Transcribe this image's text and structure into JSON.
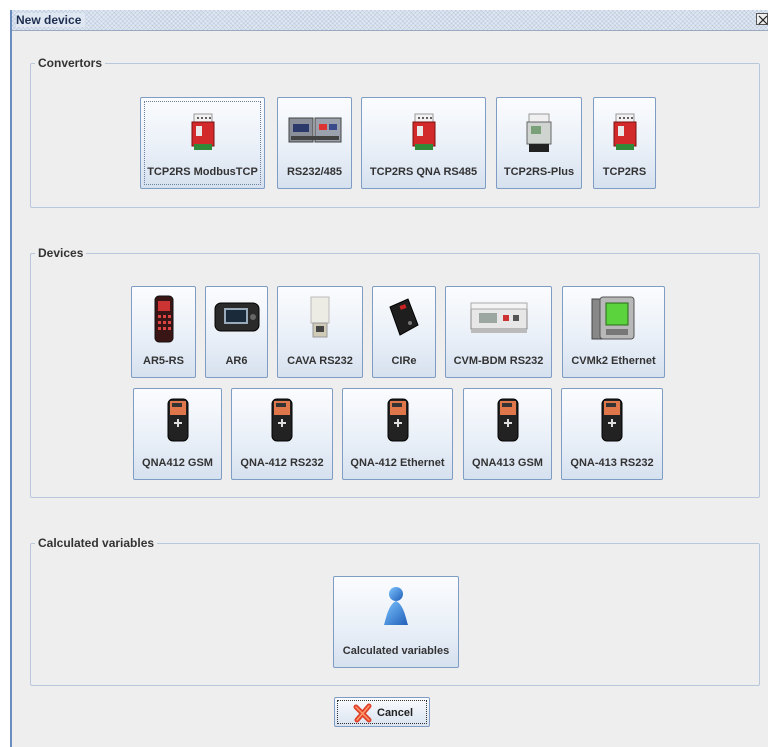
{
  "window": {
    "title": "New device"
  },
  "convertors": {
    "label": "Convertors",
    "items": [
      {
        "label": "TCP2RS ModbusTCP",
        "icon": "red-din-module-icon"
      },
      {
        "label": "RS232/485",
        "icon": "dual-din-module-icon"
      },
      {
        "label": "TCP2RS QNA RS485",
        "icon": "red-din-module-icon"
      },
      {
        "label": "TCP2RS-Plus",
        "icon": "gray-din-module-icon"
      },
      {
        "label": "TCP2RS",
        "icon": "red-din-module-icon"
      }
    ]
  },
  "devices": {
    "label": "Devices",
    "row1": [
      {
        "label": "AR5-RS",
        "icon": "handheld-analyzer-icon"
      },
      {
        "label": "AR6",
        "icon": "portable-analyzer-icon"
      },
      {
        "label": "CAVA RS232",
        "icon": "white-box-device-icon"
      },
      {
        "label": "CIRe",
        "icon": "black-box-device-icon"
      },
      {
        "label": "CVM-BDM RS232",
        "icon": "din-meter-icon"
      },
      {
        "label": "CVMk2 Ethernet",
        "icon": "panel-meter-icon"
      }
    ],
    "row2": [
      {
        "label": "QNA412 GSM",
        "icon": "qna-analyzer-icon"
      },
      {
        "label": "QNA-412 RS232",
        "icon": "qna-analyzer-icon"
      },
      {
        "label": "QNA-412 Ethernet",
        "icon": "qna-analyzer-icon"
      },
      {
        "label": "QNA413 GSM",
        "icon": "qna-analyzer-icon"
      },
      {
        "label": "QNA-413 RS232",
        "icon": "qna-analyzer-icon"
      }
    ]
  },
  "calculated": {
    "label": "Calculated variables",
    "button_label": "Calculated variables",
    "icon": "blue-person-icon"
  },
  "footer": {
    "cancel_label": "Cancel",
    "cancel_icon": "red-x-icon"
  }
}
